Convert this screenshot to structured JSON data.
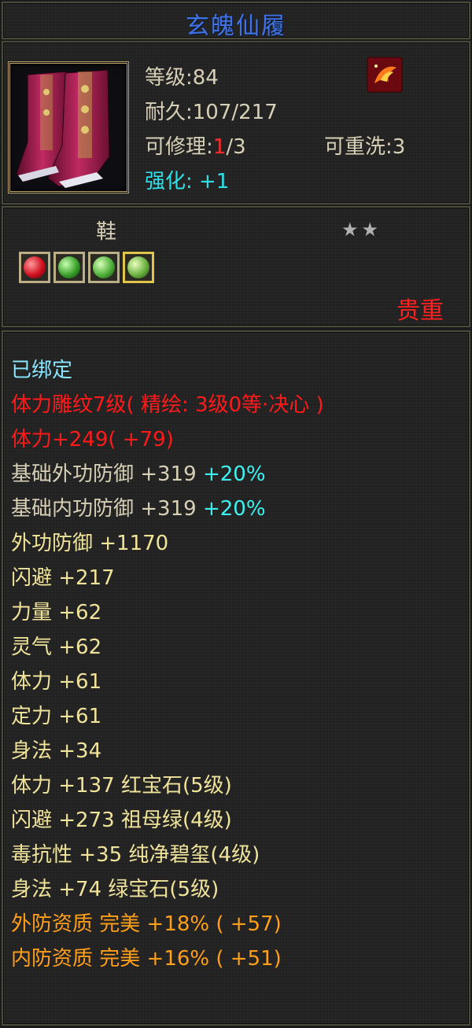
{
  "item": {
    "name": "玄魄仙履",
    "level": "等级:84",
    "durability": "耐久:107/217",
    "repair_label": "可修理:",
    "repair_current": "1",
    "repair_total": "/3",
    "rewash": "可重洗:3",
    "strengthen": "强化: +1",
    "slot_type": "鞋",
    "stars": "★★",
    "rarity": "贵重"
  },
  "icons": {
    "portrait": "pink-boots-icon",
    "special": "phoenix-emblem-icon",
    "gems": [
      "red-gem-icon",
      "green-gem-icon",
      "green-gem-icon",
      "green-gem-icon"
    ]
  },
  "colors": {
    "title": "#3f73e6",
    "bound": "#8ae6ff",
    "red_attr": "#ff1a1a",
    "base_attr": "#d8d0b6",
    "yellow_attr": "#f0e39a",
    "percent": "#3df2f0",
    "quality": "#ff9f1a"
  },
  "attributes": {
    "bound": "已绑定",
    "engrave": "体力雕纹7级( 精绘: 3级0等·决心 )",
    "engrave_stat": "体力+249( +79)",
    "base_outer_def": "基础外功防御 +319",
    "base_outer_def_pct": "+20%",
    "base_inner_def": "基础内功防御 +319",
    "base_inner_def_pct": "+20%",
    "outer_def": "外功防御 +1170",
    "dodge": "闪避 +217",
    "strength": "力量 +62",
    "spirit": "灵气 +62",
    "stamina": "体力 +61",
    "focus": "定力 +61",
    "agility": "身法 +34",
    "gem_stamina": "体力 +137 红宝石(5级)",
    "gem_dodge": "闪避 +273 祖母绿(4级)",
    "gem_poison": "毒抗性 +35 纯净碧玺(4级)",
    "gem_agility": "身法 +74 绿宝石(5级)",
    "outer_quality": "外防资质 完美 +18% ( +57)",
    "inner_quality": "内防资质 完美 +16% ( +51)"
  }
}
